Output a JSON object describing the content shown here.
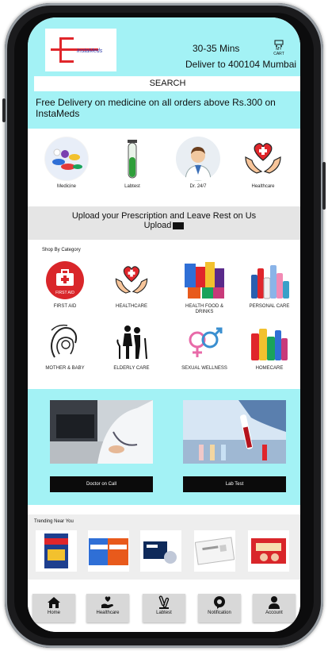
{
  "header": {
    "logo_text": "InstaMeds",
    "eta": "30-35 Mins",
    "deliver_to": "Deliver to 400104 Mumbai",
    "cart_label": "MY CART",
    "search_label": "SEARCH",
    "promo": "Free Delivery on  medicine on all orders above Rs.300 on InstaMeds"
  },
  "services": [
    {
      "label": "Medicine",
      "icon": "pills-icon"
    },
    {
      "label": "Labtest",
      "icon": "test-tube-icon"
    },
    {
      "label": "Dr. 24/7",
      "icon": "doctor-icon"
    },
    {
      "label": "Healthcare",
      "icon": "heart-hands-icon"
    }
  ],
  "upload": {
    "line1": "Upload your Prescription and Leave Rest on Us",
    "line2": "Upload"
  },
  "categories": {
    "title": "Shop By Category",
    "items": [
      {
        "label": "FIRST AID",
        "icon": "first-aid-icon"
      },
      {
        "label": "HEALTHCARE",
        "icon": "heart-hands-icon"
      },
      {
        "label": "HEALTH FOOD & DRINKS",
        "icon": "health-food-icon"
      },
      {
        "label": "PERSONAL CARE",
        "icon": "personal-care-icon"
      },
      {
        "label": "MOTHER & BABY",
        "icon": "mother-baby-icon"
      },
      {
        "label": "ELDERLY CARE",
        "icon": "elderly-icon"
      },
      {
        "label": "SEXUAL WELLNESS",
        "icon": "gender-icon"
      },
      {
        "label": "HOMECARE",
        "icon": "homecare-icon"
      }
    ]
  },
  "ondemand": {
    "doctor_button": "Doctor on Call",
    "lab_button": "Lab Test"
  },
  "trending": {
    "title": "Trending Near You"
  },
  "nav": [
    {
      "label": "Home",
      "icon": "home-icon"
    },
    {
      "label": "Healthcare",
      "icon": "healthcare-icon"
    },
    {
      "label": "Labtest",
      "icon": "labtest-icon"
    },
    {
      "label": "Notification",
      "icon": "notification-icon"
    },
    {
      "label": "Account",
      "icon": "account-icon"
    }
  ],
  "colors": {
    "accent": "#a3f2f5",
    "brand_red": "#e0262b",
    "nav_bg": "#d8d8d8",
    "button_dark": "#0b0b0b"
  }
}
